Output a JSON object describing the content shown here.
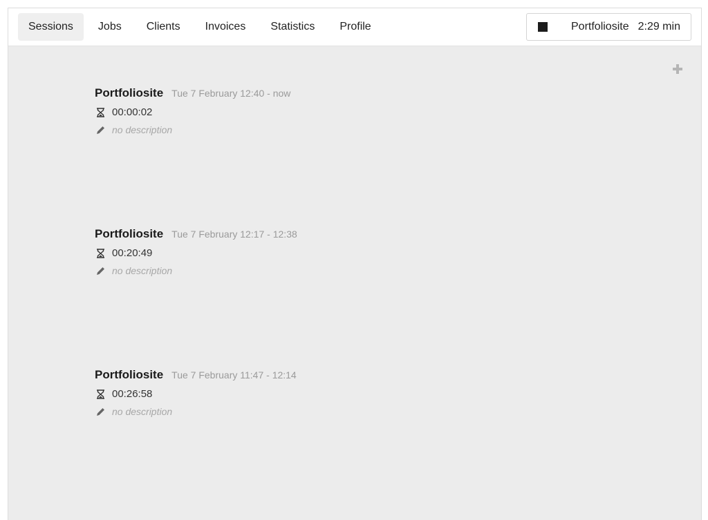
{
  "nav": {
    "tabs": [
      {
        "label": "Sessions",
        "active": true
      },
      {
        "label": "Jobs"
      },
      {
        "label": "Clients"
      },
      {
        "label": "Invoices"
      },
      {
        "label": "Statistics"
      },
      {
        "label": "Profile"
      }
    ]
  },
  "timer": {
    "icon": "stop-icon",
    "project": "Portfoliosite",
    "elapsed": "2:29 min"
  },
  "add_icon": "plus-icon",
  "sessions": [
    {
      "project": "Portfoliosite",
      "time": "Tue 7 February 12:40 - now",
      "duration": "00:00:02",
      "description": "no description"
    },
    {
      "project": "Portfoliosite",
      "time": "Tue 7 February 12:17 - 12:38",
      "duration": "00:20:49",
      "description": "no description"
    },
    {
      "project": "Portfoliosite",
      "time": "Tue 7 February 11:47 - 12:14",
      "duration": "00:26:58",
      "description": "no description"
    }
  ],
  "colors": {
    "background": "#ececec",
    "navbar": "#ffffff",
    "active_tab": "#efefef",
    "muted_text": "#9a9a9a"
  }
}
